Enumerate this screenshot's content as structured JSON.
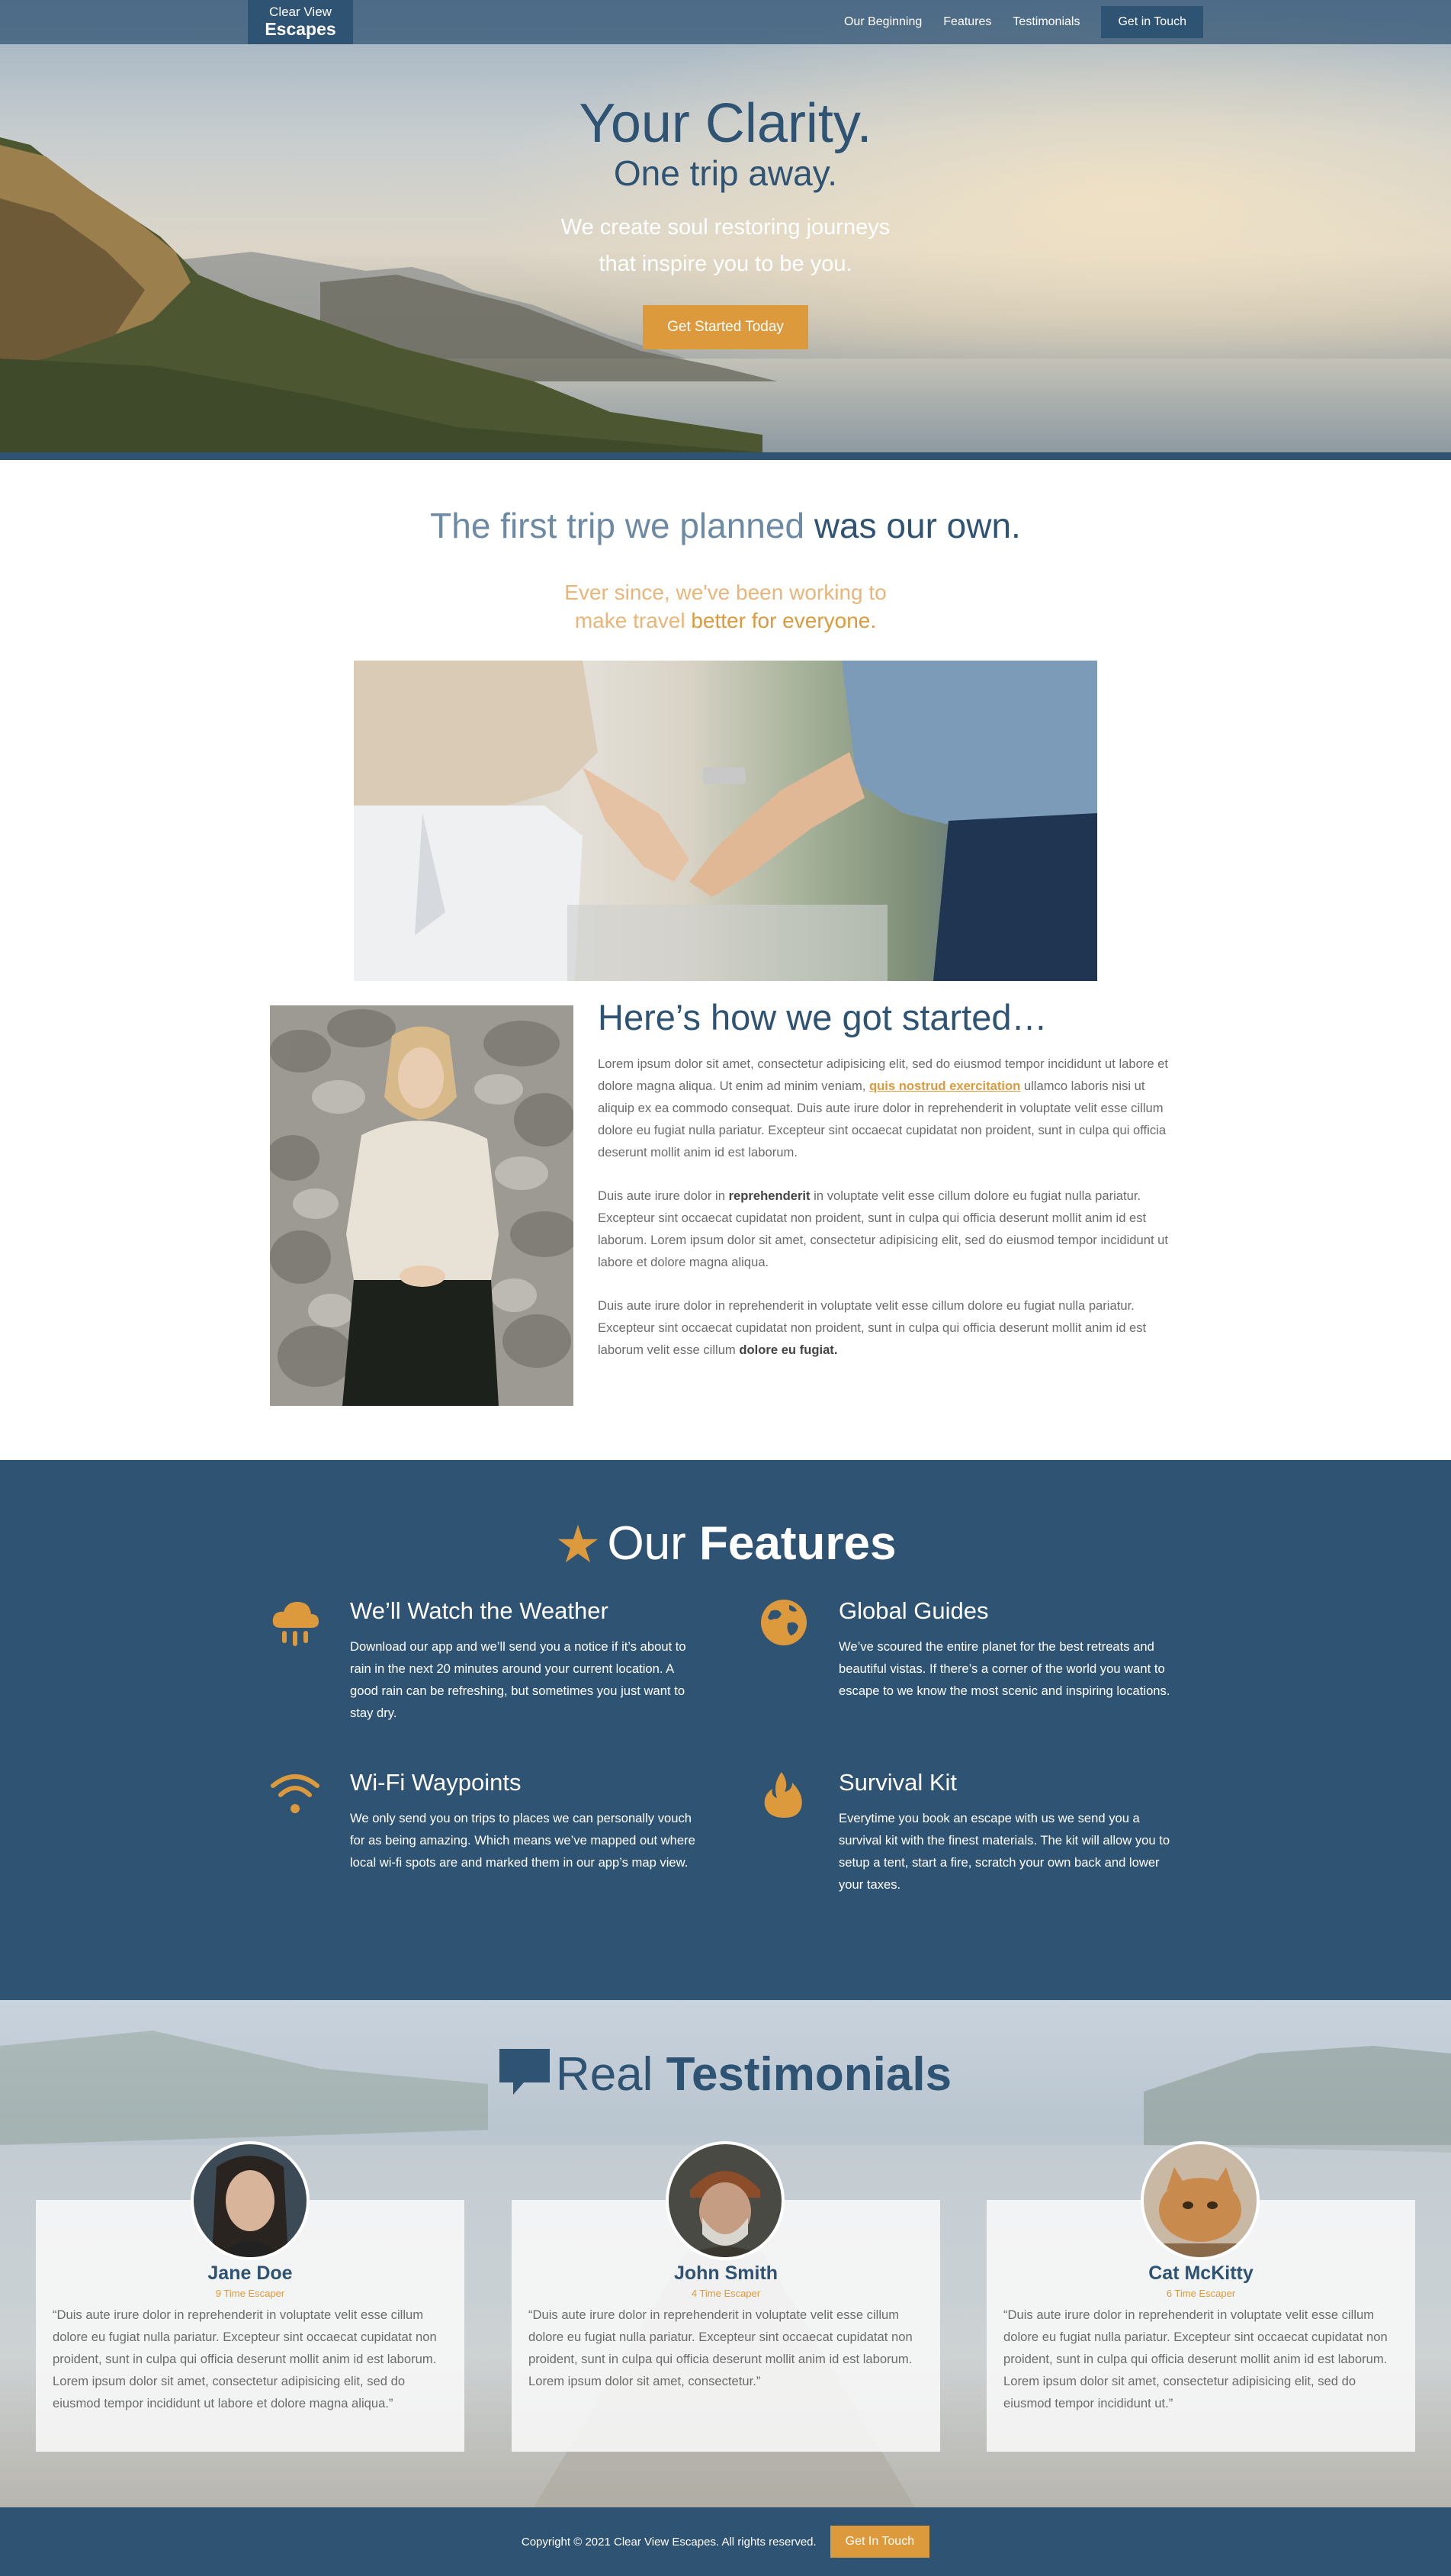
{
  "nav": {
    "logo_top": "Clear View",
    "logo_bottom": "Escapes",
    "links": [
      "Our Beginning",
      "Features",
      "Testimonials"
    ],
    "cta": "Get in Touch"
  },
  "hero": {
    "title": "Your Clarity.",
    "subtitle": "One trip away.",
    "tagline_1": "We create soul restoring journeys",
    "tagline_2": "that inspire you to be you.",
    "cta": "Get Started Today"
  },
  "story": {
    "heading_light": "The first trip we planned",
    "heading_bold": "was our own.",
    "sub_line1": "Ever since, we've been working to",
    "sub_line2_light": "make travel",
    "sub_line2_bold": "better for everyone.",
    "started_heading": "Here’s how we got started…",
    "p1_a": "Lorem ipsum dolor sit amet, consectetur adipisicing elit, sed do eiusmod tempor incididunt ut labore et dolore magna aliqua. Ut enim ad minim veniam,",
    "p1_link": "quis nostrud exercitation",
    "p1_b": "ullamco laboris nisi ut aliquip ex ea commodo consequat. Duis aute irure dolor in reprehenderit in voluptate velit esse cillum dolore eu fugiat nulla pariatur. Excepteur sint occaecat cupidatat non proident, sunt in culpa qui officia deserunt mollit anim id est laborum.",
    "p2_a": "Duis aute irure dolor in",
    "p2_bold": "reprehenderit",
    "p2_b": "in voluptate velit esse cillum dolore eu fugiat nulla pariatur. Excepteur sint occaecat cupidatat non proident, sunt in culpa qui officia deserunt mollit anim id est laborum. Lorem ipsum dolor sit amet, consectetur adipisicing elit, sed do eiusmod tempor incididunt ut labore et dolore magna aliqua.",
    "p3_a": "Duis aute irure dolor in reprehenderit in voluptate velit esse cillum dolore eu fugiat nulla pariatur. Excepteur sint occaecat cupidatat non proident, sunt in culpa qui officia deserunt mollit anim id est laborum velit esse cillum",
    "p3_bold": "dolore eu fugiat."
  },
  "features": {
    "title_light": "Our",
    "title_bold": "Features",
    "items": [
      {
        "icon": "cloud-rain-icon",
        "title": "We’ll Watch the Weather",
        "text": "Download our app and we’ll send you a notice if it’s about to rain in the next 20 minutes around your current location. A good rain can be refreshing, but sometimes you just want to stay dry."
      },
      {
        "icon": "globe-icon",
        "title": "Global Guides",
        "text": "We’ve scoured the entire planet for the best retreats and beautiful vistas. If there’s a corner of the world you want to escape to we know the most scenic and inspiring locations."
      },
      {
        "icon": "wifi-icon",
        "title": "Wi-Fi Waypoints",
        "text": "We only send you on trips to places we can personally vouch for as being amazing. Which means we’ve mapped out where local wi-fi spots are and marked them in our app’s map view."
      },
      {
        "icon": "fire-icon",
        "title": "Survival Kit",
        "text": "Everytime you book an escape with us we send you a survival kit with the finest materials. The kit will allow you to setup a tent, start a fire, scratch your own back and lower your taxes."
      }
    ]
  },
  "testimonials": {
    "title_light": "Real",
    "title_bold": "Testimonials",
    "items": [
      {
        "name": "Jane Doe",
        "tag": "9 Time Escaper",
        "quote": "“Duis aute irure dolor in reprehenderit in voluptate velit esse cillum dolore eu fugiat nulla pariatur. Excepteur sint occaecat cupidatat non proident, sunt in culpa qui officia deserunt mollit anim id est laborum. Lorem ipsum dolor sit amet, consectetur adipisicing elit, sed do eiusmod tempor incididunt ut labore et dolore magna aliqua.”"
      },
      {
        "name": "John Smith",
        "tag": "4 Time Escaper",
        "quote": "“Duis aute irure dolor in reprehenderit in voluptate velit esse cillum dolore eu fugiat nulla pariatur. Excepteur sint occaecat cupidatat non proident, sunt in culpa qui officia deserunt mollit anim id est laborum. Lorem ipsum dolor sit amet, consectetur.”"
      },
      {
        "name": "Cat McKitty",
        "tag": "6 Time Escaper",
        "quote": "“Duis aute irure dolor in reprehenderit in voluptate velit esse cillum dolore eu fugiat nulla pariatur. Excepteur sint occaecat cupidatat non proident, sunt in culpa qui officia deserunt mollit anim id est laborum. Lorem ipsum dolor sit amet, consectetur adipisicing elit, sed do eiusmod tempor incididunt ut.”"
      }
    ]
  },
  "footer": {
    "copyright": "Copyright © 2021 Clear View Escapes. All rights reserved.",
    "cta": "Get In Touch"
  },
  "colors": {
    "primary": "#2f5373",
    "accent": "#dc9a3d"
  }
}
